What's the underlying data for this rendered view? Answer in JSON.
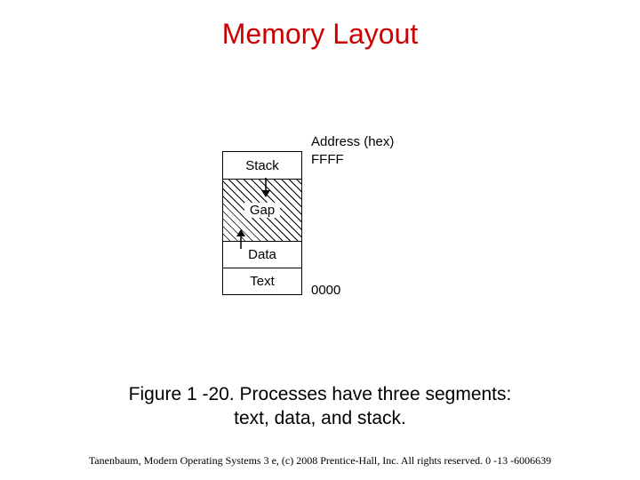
{
  "title": "Memory Layout",
  "diagram": {
    "address_label": "Address (hex)",
    "addr_top": "FFFF",
    "addr_bot": "0000",
    "segments": {
      "stack": "Stack",
      "gap": "Gap",
      "data": "Data",
      "text": "Text"
    }
  },
  "caption": {
    "line1": "Figure 1 -20. Processes have three segments:",
    "line2": "text, data, and stack."
  },
  "footer": "Tanenbaum, Modern Operating Systems 3 e, (c) 2008 Prentice-Hall, Inc. All rights reserved. 0 -13 -6006639"
}
